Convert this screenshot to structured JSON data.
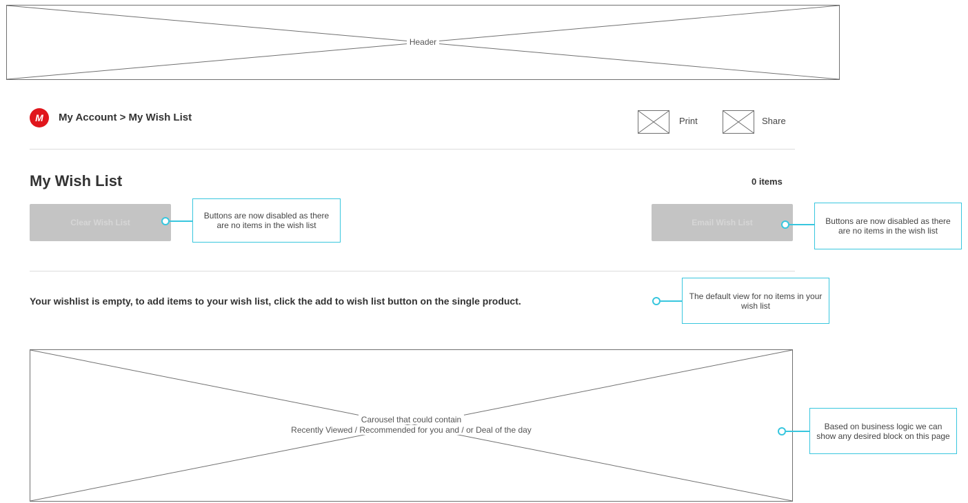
{
  "header": {
    "label": "Header"
  },
  "breadcrumb": {
    "logo_letter": "M",
    "text": "My Account > My Wish List"
  },
  "toolbar": {
    "print_label": "Print",
    "share_label": "Share"
  },
  "wishlist": {
    "title": "My Wish List",
    "item_count": "0 items",
    "left_button_label": "Clear Wish List",
    "right_button_label": "Email Wish List",
    "empty_message": "Your wishlist is empty, to add items to your wish list, click the add to wish list button on the single product."
  },
  "carousel": {
    "line1": "Carousel that could contain",
    "line2": "Recently Viewed / Recommended for you and / or Deal of the day"
  },
  "annotations": {
    "buttons_left": "Buttons are now disabled as there are no items in the wish list",
    "buttons_right": "Buttons are now disabled as there are no items in the wish list",
    "empty_view": "The default view for no items in your wish list",
    "carousel": "Based on business logic we can show any desired block on this page"
  },
  "colors": {
    "brand": "#e0161c",
    "annotation": "#37c6de",
    "disabled_button": "#c4c4c4"
  }
}
